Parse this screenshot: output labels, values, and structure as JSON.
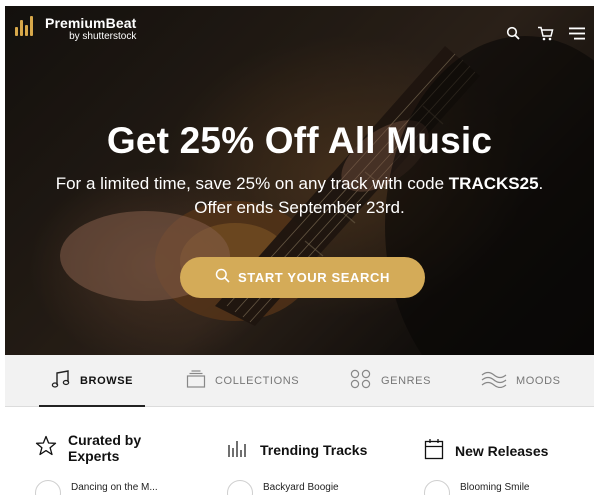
{
  "brand": {
    "name": "PremiumBeat",
    "sub": "by shutterstock",
    "accent": "#d4ab58"
  },
  "header": {
    "icons": [
      "search-icon",
      "cart-icon",
      "menu-icon"
    ]
  },
  "hero": {
    "headline": "Get 25% Off All Music",
    "line1_prefix": "For a limited time, save 25% on any track with code ",
    "code": "TRACKS25",
    "line1_suffix": ".",
    "line2": "Offer ends September 23rd.",
    "cta_label": "START YOUR SEARCH"
  },
  "tabs": [
    {
      "label": "BROWSE",
      "icon": "music-note-icon",
      "active": true
    },
    {
      "label": "COLLECTIONS",
      "icon": "collections-icon",
      "active": false
    },
    {
      "label": "GENRES",
      "icon": "genres-icon",
      "active": false
    },
    {
      "label": "MOODS",
      "icon": "waves-icon",
      "active": false
    }
  ],
  "categories": [
    {
      "label": "Curated by Experts",
      "icon": "star-icon"
    },
    {
      "label": "Trending Tracks",
      "icon": "bars-icon"
    },
    {
      "label": "New Releases",
      "icon": "calendar-icon"
    }
  ],
  "tracks": [
    {
      "name": "Dancing on the M..."
    },
    {
      "name": "Backyard Boogie"
    },
    {
      "name": "Blooming Smile"
    }
  ]
}
